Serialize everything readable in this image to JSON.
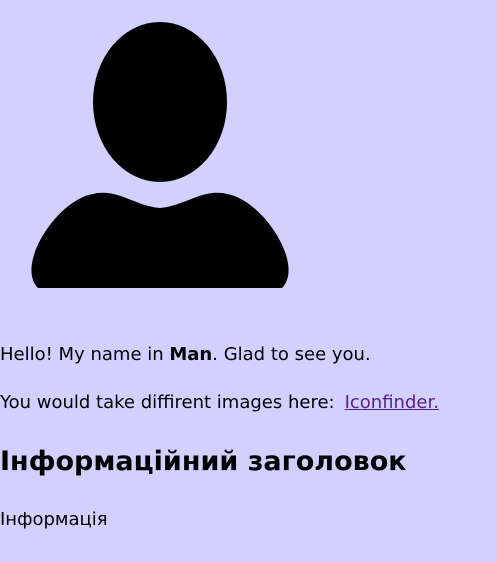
{
  "avatar": {
    "icon": "person-icon",
    "color": "#000000"
  },
  "intro": {
    "before": "Hello! My name in ",
    "name": "Man",
    "after": ". Glad to see you."
  },
  "images": {
    "text": "You would take diffirent images here:",
    "link_text": "Iconfinder."
  },
  "heading": "Інформаційний заголовок",
  "paragraph": "Інформація",
  "colors": {
    "background": "#d1d0ff",
    "text": "#000000",
    "link": "#5a1f86"
  }
}
